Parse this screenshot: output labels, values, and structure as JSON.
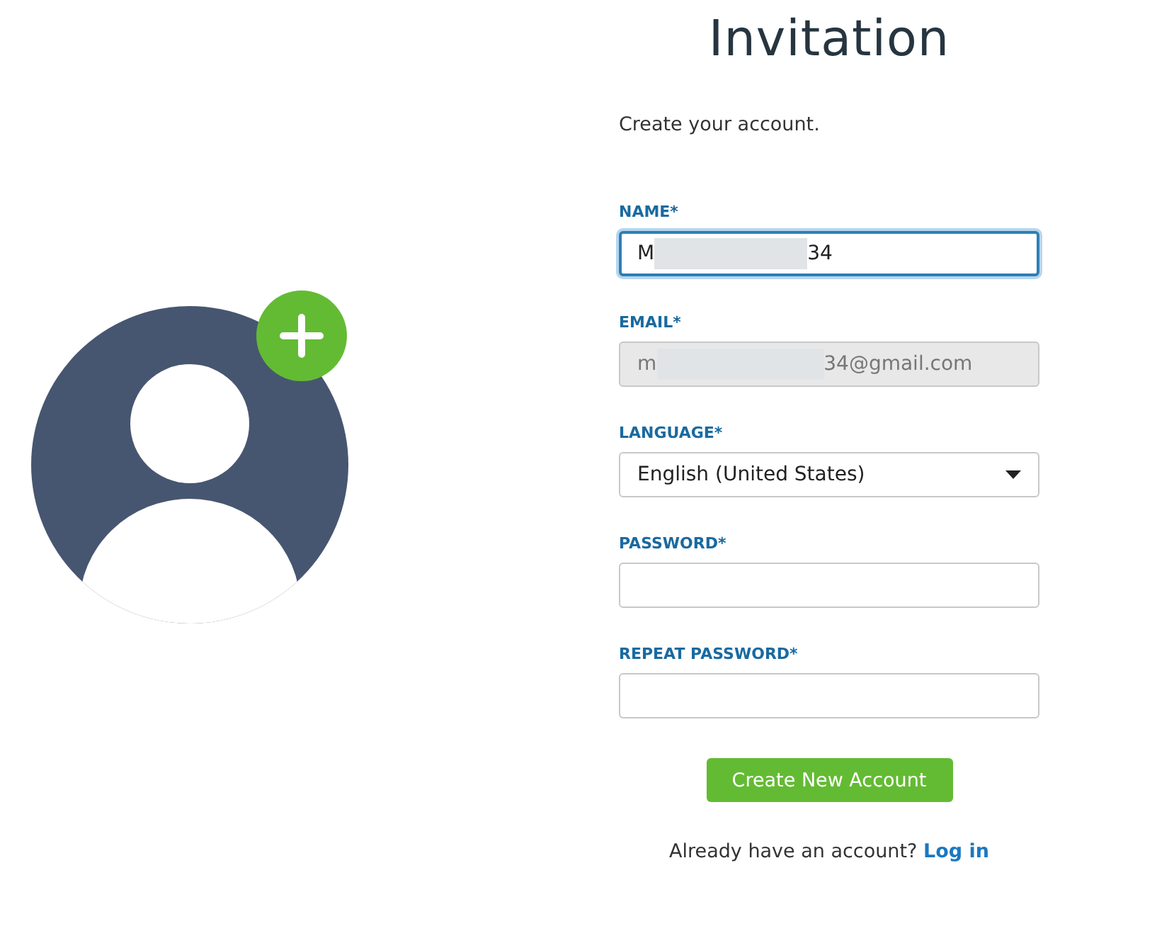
{
  "title": "Invitation",
  "subtitle": "Create your account.",
  "avatar": {
    "add_badge": true
  },
  "fields": [
    {
      "kind": "text",
      "label": "NAME*",
      "value_parts": [
        "M",
        "34"
      ],
      "focused": true,
      "disabled": false
    },
    {
      "kind": "text",
      "label": "EMAIL*",
      "value_parts": [
        "m",
        "34@gmail.com"
      ],
      "focused": false,
      "disabled": true
    },
    {
      "kind": "select",
      "label": "LANGUAGE*",
      "value_parts": [
        "English (United States)"
      ],
      "focused": false,
      "disabled": false
    },
    {
      "kind": "password",
      "label": "PASSWORD*",
      "focused": false,
      "disabled": false
    },
    {
      "kind": "password",
      "label": "REPEAT PASSWORD*",
      "focused": false,
      "disabled": false
    }
  ],
  "submit": "Create New Account",
  "login_prompt": "Already have an account?",
  "login_link": "Log in"
}
